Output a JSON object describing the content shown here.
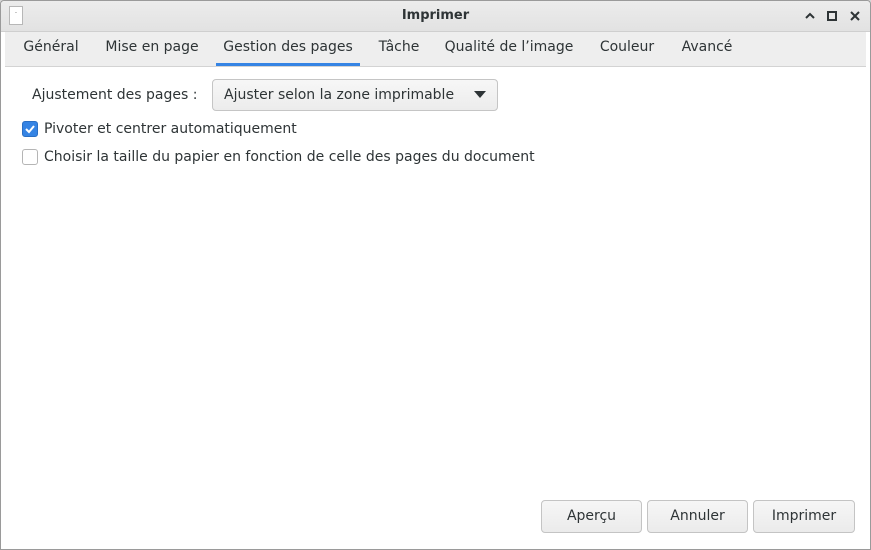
{
  "window": {
    "title": "Imprimer",
    "app_icon_text": "·",
    "controls": {
      "minimize_icon": "chevron-up-icon",
      "maximize_icon": "square-icon",
      "close_icon": "close-icon"
    }
  },
  "tabs": [
    {
      "label": "Général",
      "active": false
    },
    {
      "label": "Mise en page",
      "active": false
    },
    {
      "label": "Gestion des pages",
      "active": true
    },
    {
      "label": "Tâche",
      "active": false
    },
    {
      "label": "Qualité de l’image",
      "active": false
    },
    {
      "label": "Couleur",
      "active": false
    },
    {
      "label": "Avancé",
      "active": false
    }
  ],
  "page_handling": {
    "fit_label": "Ajustement des pages :",
    "fit_value": "Ajuster selon la zone imprimable",
    "options": [
      {
        "label": "Pivoter et centrer automatiquement",
        "checked": true
      },
      {
        "label": "Choisir la taille du papier en fonction de celle des pages du document",
        "checked": false
      }
    ]
  },
  "footer": {
    "preview_label": "Aperçu",
    "cancel_label": "Annuler",
    "print_label": "Imprimer"
  },
  "colors": {
    "accent": "#3584e4"
  }
}
